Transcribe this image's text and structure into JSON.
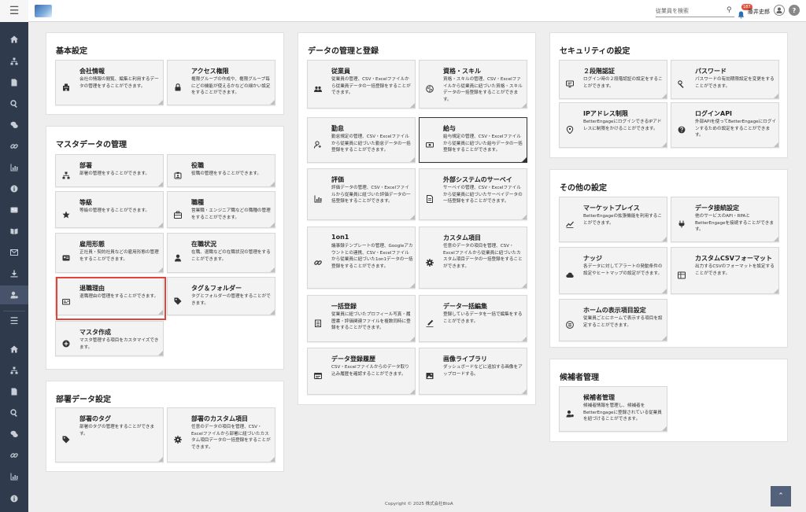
{
  "header": {
    "search_placeholder": "従業員を検索",
    "notification_count": "187",
    "user_name": "藤井史郎"
  },
  "sidebar": {
    "top_icons": [
      "home-icon",
      "org-chart-icon",
      "document-icon",
      "search-icon",
      "chat-icon",
      "link-icon",
      "chart-icon",
      "info-icon",
      "id-card-icon",
      "book-icon",
      "mail-icon",
      "download-icon",
      "user-settings-icon"
    ],
    "bottom_icons": [
      "home-icon",
      "org-chart-icon",
      "document-icon",
      "search-icon",
      "chat-icon",
      "link-icon",
      "chart-icon",
      "info-icon"
    ]
  },
  "sections": {
    "basic": {
      "title": "基本設定",
      "cards": [
        {
          "title": "会社情報",
          "desc": "会社の情報の閲覧、編集と利用するデータの管理をすることができます。",
          "icon": "building-icon"
        },
        {
          "title": "アクセス権限",
          "desc": "権限グループの作成や、権限グループ毎にどの機能が使えるかなどの細かい設定をすることができます。",
          "icon": "lock-icon"
        }
      ]
    },
    "master": {
      "title": "マスタデータの管理",
      "cards": [
        {
          "title": "部署",
          "desc": "部署の管理をすることができます。",
          "icon": "org-chart-icon"
        },
        {
          "title": "役職",
          "desc": "役職の管理をすることができます。",
          "icon": "badge-icon"
        },
        {
          "title": "等級",
          "desc": "等級の管理をすることができます。",
          "icon": "star-icon"
        },
        {
          "title": "職種",
          "desc": "営業職・エンジニア職などの職種の管理をすることができます。",
          "icon": "briefcase-icon"
        },
        {
          "title": "雇用形態",
          "desc": "正社員・契約社員などの雇用形態の管理をすることができます。",
          "icon": "id-card-icon"
        },
        {
          "title": "在職状況",
          "desc": "在職、退職などの在職状況の管理をすることができます。",
          "icon": "user-status-icon"
        },
        {
          "title": "退職理由",
          "desc": "退職理由の管理をすることができます。",
          "icon": "door-icon"
        },
        {
          "title": "タグ＆フォルダー",
          "desc": "タグとフォルダーの管理をすることができます。",
          "icon": "tag-icon"
        },
        {
          "title": "マスタ作成",
          "desc": "マスタ管理する項目をカスタマイズできます。",
          "icon": "plus-circle-icon"
        }
      ]
    },
    "department": {
      "title": "部署データ設定",
      "cards": [
        {
          "title": "部署のタグ",
          "desc": "部署のタグの管理をすることができます。",
          "icon": "tag-icon"
        },
        {
          "title": "部署のカスタム項目",
          "desc": "任意のデータの項目を管理、CSV・Excelファイルから部署に紐づいたカスタム項目データの一括登録をすることができます。",
          "icon": "gear-icon"
        }
      ]
    },
    "data": {
      "title": "データの管理と登録",
      "cards": [
        {
          "title": "従業員",
          "desc": "従業員の管理、CSV・Excelファイルから従業員データの一括登録をすることができます。",
          "icon": "group-icon"
        },
        {
          "title": "資格・スキル",
          "desc": "資格・スキルの管理、CSV・Excelファイルから従業員に紐づいた資格・スキルデータの一括登録をすることができます。",
          "icon": "brain-icon"
        },
        {
          "title": "勤怠",
          "desc": "勤怠規定の管理、CSV・Excelファイルから従業員に紐づいた勤怠データの一括登録をすることができます。",
          "icon": "user-clock-icon"
        },
        {
          "title": "給与",
          "desc": "給与規定の管理、CSV・Excelファイルから従業員に紐づいた給与データの一括登録をすることができます。",
          "icon": "money-icon"
        },
        {
          "title": "評価",
          "desc": "評価データの管理、CSV・Excelファイルから従業員に紐づいた評価データの一括登録をすることができます。",
          "icon": "chart-icon"
        },
        {
          "title": "外部システムのサーベイ",
          "desc": "サーベイの管理、CSV・Excelファイルから従業員に紐づいたサーベイデータの一括登録をすることができます。",
          "icon": "survey-icon"
        },
        {
          "title": "1on1",
          "desc": "議事録テンプレートの管理、Googleアカウントとの連携、CSV・Excelファイルから従業員に紐づいた1on1データの一括登録をすることができます。",
          "icon": "link-icon"
        },
        {
          "title": "カスタム項目",
          "desc": "任意のデータの項目を管理、CSV・Excelファイルから従業員に紐づいたカスタム項目データの一括登録をすることができます。",
          "icon": "gear-icon"
        },
        {
          "title": "一括登録",
          "desc": "従業員に紐づいたプロフィール写真・履歴書・評価関連ファイルを複数同時に登録をすることができます。",
          "icon": "file-stack-icon"
        },
        {
          "title": "データ一括編集",
          "desc": "登録しているデータを一括で編集をすることができます。",
          "icon": "pen-icon"
        },
        {
          "title": "データ登録履歴",
          "desc": "CSV・Excelファイルからのデータ取り込み履歴を確認することができます。",
          "icon": "history-icon"
        },
        {
          "title": "画像ライブラリ",
          "desc": "ダッシュボードなどに追加する画像をアップロードする。",
          "icon": "image-icon"
        }
      ]
    },
    "security": {
      "title": "セキュリティの設定",
      "cards": [
        {
          "title": "２段階認証",
          "desc": "ログイン時の２段階認証の設定をすることができます。",
          "icon": "screen-icon"
        },
        {
          "title": "パスワード",
          "desc": "パスワードの有効期限設定を変更をすることができます。",
          "icon": "key-icon"
        },
        {
          "title": "IPアドレス制限",
          "desc": "BetterEngageにログインできるIPアドレスに制限をかけることができます。",
          "icon": "location-icon"
        },
        {
          "title": "ログインAPI",
          "desc": "外部APIを使ってBetterEngageにログインするための設定をすることができます。",
          "icon": "login-icon"
        }
      ]
    },
    "other": {
      "title": "その他の設定",
      "cards": [
        {
          "title": "マーケットプレイス",
          "desc": "BetterEngageの拡張機能を利用することができます。",
          "icon": "trend-icon"
        },
        {
          "title": "データ接続設定",
          "desc": "他のサービスのAPI・RPAとBetterEngageを接続することができます。",
          "icon": "plug-icon"
        },
        {
          "title": "ナッジ",
          "desc": "各データに対してアラートの発動条件の設定やヒートマップの設定ができます。",
          "icon": "cloud-icon"
        },
        {
          "title": "カスタムCSVフォーマット",
          "desc": "出力するCSVのフォーマットを設定することができます。",
          "icon": "csv-icon"
        },
        {
          "title": "ホームの表示項目設定",
          "desc": "従業員ごとにホームで表示する項目を設定することができます。",
          "icon": "home-list-icon"
        }
      ]
    },
    "candidate": {
      "title": "候補者管理",
      "cards": [
        {
          "title": "候補者管理",
          "desc": "候補者情報を管理し、候補者をBetterEngageに登録されている従業員を紐づけることができます。",
          "icon": "candidate-icon"
        }
      ]
    }
  },
  "footer": {
    "copyright": "Copyright © 2025 株式会社BtoA"
  }
}
